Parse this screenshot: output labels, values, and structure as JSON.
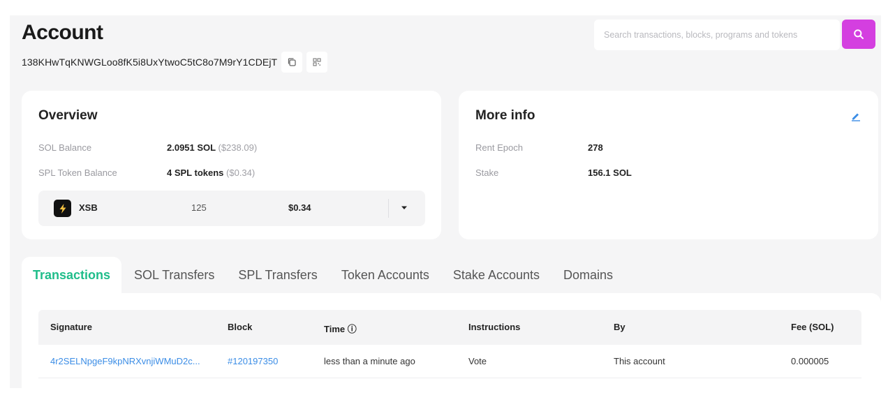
{
  "header": {
    "title": "Account",
    "address": "138KHwTqKNWGLoo8fK5i8UxYtwoC5tC8o7M9rY1CDEjT",
    "search_placeholder": "Search transactions, blocks, programs and tokens"
  },
  "overview": {
    "title": "Overview",
    "sol_balance_label": "SOL Balance",
    "sol_balance_value": "2.0951 SOL",
    "sol_balance_usd": "($238.09)",
    "spl_balance_label": "SPL Token Balance",
    "spl_balance_value": "4 SPL tokens",
    "spl_balance_usd": "($0.34)",
    "token": {
      "symbol": "XSB",
      "amount": "125",
      "value": "$0.34"
    }
  },
  "more_info": {
    "title": "More info",
    "rent_epoch_label": "Rent Epoch",
    "rent_epoch_value": "278",
    "stake_label": "Stake",
    "stake_value": "156.1 SOL"
  },
  "tabs": [
    "Transactions",
    "SOL Transfers",
    "SPL Transfers",
    "Token Accounts",
    "Stake Accounts",
    "Domains"
  ],
  "table": {
    "headers": [
      "Signature",
      "Block",
      "Time ⓘ",
      "Instructions",
      "By",
      "Fee (SOL)"
    ],
    "rows": [
      [
        "4r2SELNpgeF9kpNRXvnjiWMuD2c...",
        "#120197350",
        "less than a minute ago",
        "Vote",
        "This account",
        "0.000005"
      ]
    ]
  },
  "colors": {
    "accent_purple": "#d43fe0",
    "active_tab_green": "#1fbd8a",
    "link_blue": "#3b8de6"
  },
  "icons": [
    "copy-icon",
    "qr-code-icon",
    "search-icon",
    "lightning-icon",
    "caret-down-icon",
    "edit-pencil-icon"
  ]
}
